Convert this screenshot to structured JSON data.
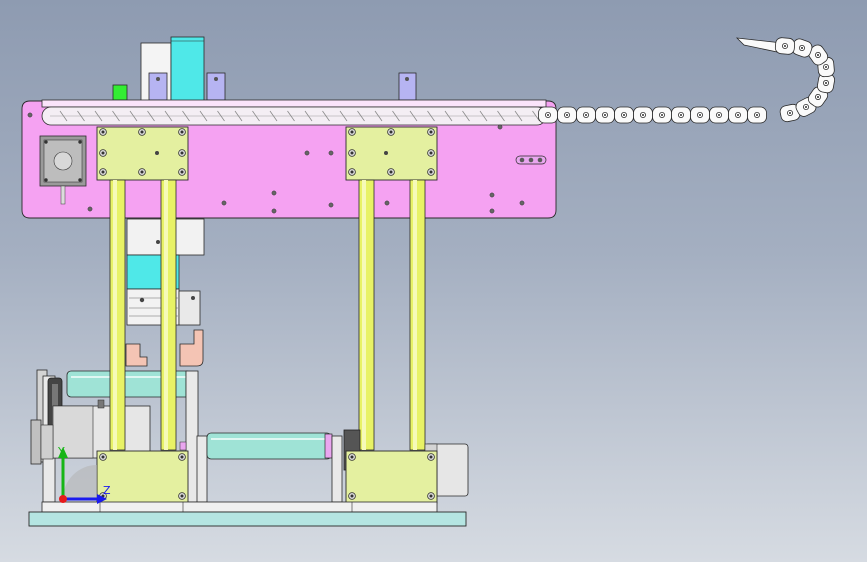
{
  "viewport": {
    "view": "cad-assembly-front-view",
    "colors": {
      "background_top": "#8e9bb1",
      "background_bottom": "#d6dbe2",
      "outline": "#2a2a2a",
      "main_plate": "#f5a2f2",
      "mount_block": "#e4f0a0",
      "guide_rod": "#e8f266",
      "roller": "#9fe3d6",
      "cable_chain": "#fafafa",
      "base_plate": "#b5e5e2",
      "motor_body": "#e6e6e6",
      "cyan_block": "#4fe8e8",
      "lavender_tab": "#b6b4f2",
      "green_indicator": "#33ee33",
      "salmon_gripper": "#f4c4b4"
    }
  },
  "triad": {
    "y_label": "Y",
    "z_label": "Z",
    "colors": {
      "y": "#16b516",
      "z": "#1a1aee",
      "x": "#e61a1a"
    }
  }
}
